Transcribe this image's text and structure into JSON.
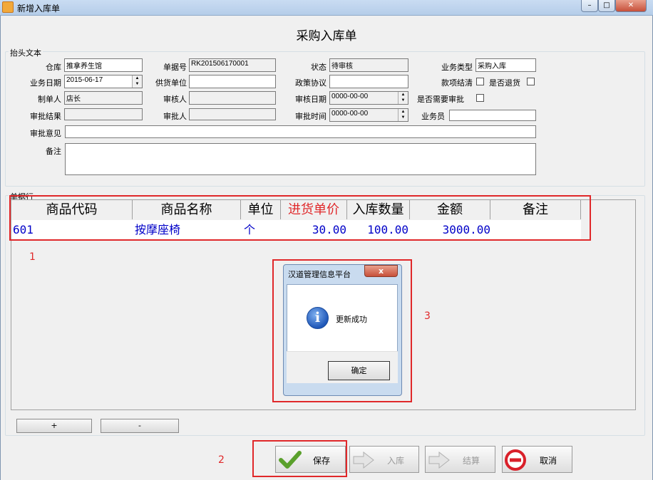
{
  "window": {
    "title": "新增入库单",
    "minimize_icon": "minimize-icon",
    "maximize_icon": "maximize-icon",
    "close_icon": "close-icon"
  },
  "form_title": "采购入库单",
  "header_group": {
    "label": "抬头文本",
    "fields": {
      "warehouse": {
        "label": "仓库",
        "value": "推拿养生馆"
      },
      "doc_no": {
        "label": "单据号",
        "value": "RK201506170001"
      },
      "status": {
        "label": "状态",
        "value": "待审核"
      },
      "biz_type": {
        "label": "业务类型",
        "value": "采购入库"
      },
      "biz_date": {
        "label": "业务日期",
        "value": "2015-06-17"
      },
      "supplier": {
        "label": "供货单位",
        "value": ""
      },
      "policy": {
        "label": "政策协议",
        "value": ""
      },
      "settled": {
        "label": "款项结清",
        "checked": false
      },
      "returned": {
        "label": "是否退货",
        "checked": false
      },
      "creator": {
        "label": "制单人",
        "value": "店长"
      },
      "auditor": {
        "label": "审核人",
        "value": ""
      },
      "audit_date": {
        "label": "审核日期",
        "value": "0000-00-00"
      },
      "need_approval": {
        "label": "是否需要审批",
        "checked": false
      },
      "approval_result": {
        "label": "审批结果",
        "value": ""
      },
      "approver": {
        "label": "审批人",
        "value": ""
      },
      "approval_time": {
        "label": "审批时间",
        "value": "0000-00-00"
      },
      "salesman": {
        "label": "业务员",
        "value": ""
      },
      "approval_opinion": {
        "label": "审批意见",
        "value": ""
      },
      "remark": {
        "label": "备注",
        "value": ""
      }
    }
  },
  "lines_group": {
    "label": "单据行",
    "columns": [
      "商品代码",
      "商品名称",
      "单位",
      "进货单价",
      "入库数量",
      "金额",
      "备注"
    ],
    "rows": [
      {
        "code": "601",
        "name": "按摩座椅",
        "unit": "个",
        "price": "30.00",
        "qty": "100.00",
        "amount": "3000.00",
        "remark": ""
      }
    ],
    "add_label": "+",
    "remove_label": "-"
  },
  "annotations": {
    "n1": "1",
    "n2": "2",
    "n3": "3"
  },
  "buttons": {
    "save": {
      "label": "保存",
      "icon": "checkmark-icon"
    },
    "stock_in": {
      "label": "入库",
      "icon": "arrow-right-icon"
    },
    "settle": {
      "label": "结算",
      "icon": "arrow-right-icon"
    },
    "cancel": {
      "label": "取消",
      "icon": "stop-icon"
    }
  },
  "dialog": {
    "title": "汉道管理信息平台",
    "message": "更新成功",
    "ok_label": "确定",
    "icon": "info-icon",
    "close_label": "x"
  },
  "colors": {
    "accent_red": "#e0282a",
    "data_blue": "#0000c8",
    "header_red": "#e0282a"
  }
}
